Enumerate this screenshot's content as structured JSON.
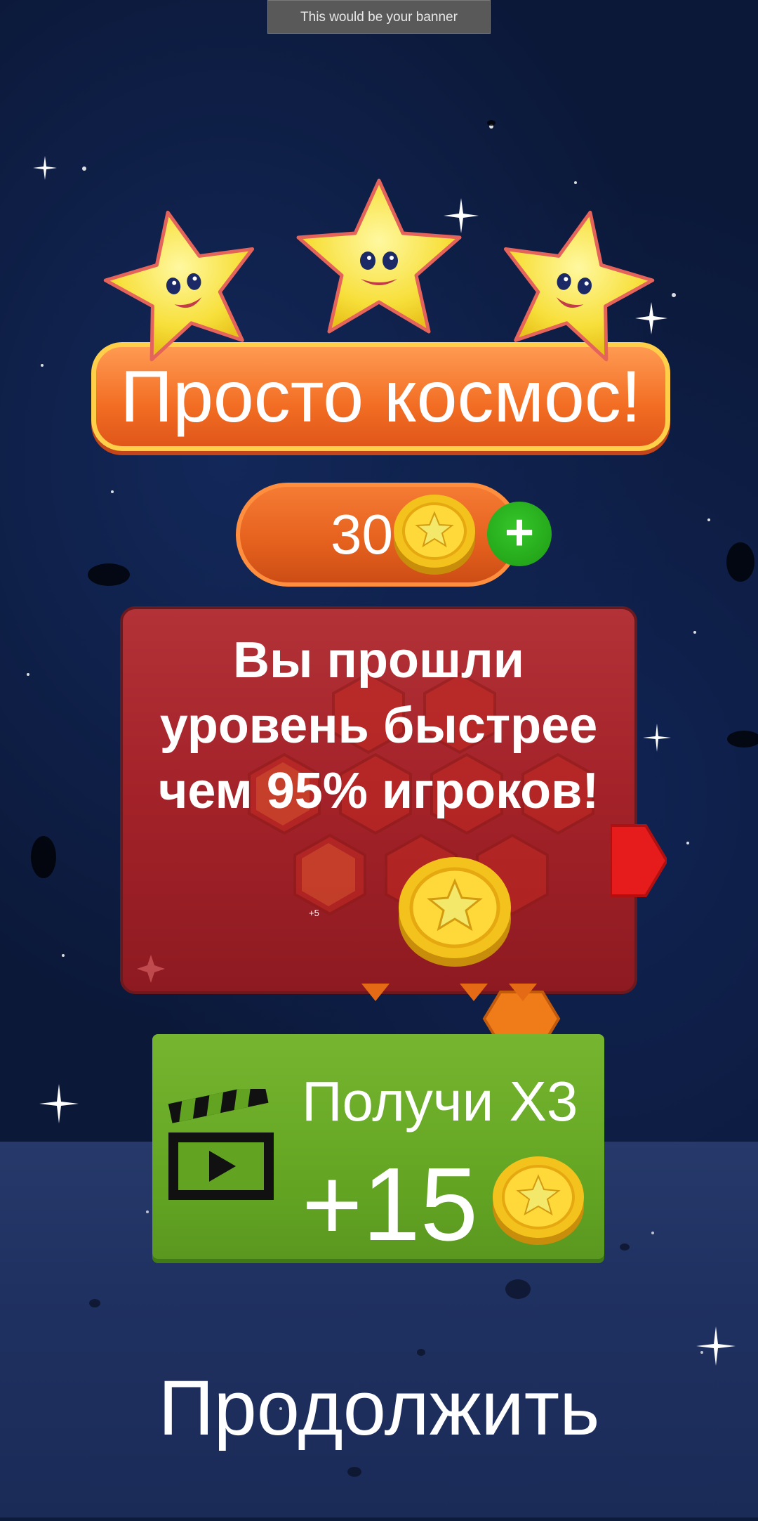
{
  "banner": {
    "text": "This would be your banner"
  },
  "title": {
    "text": "Просто космос!"
  },
  "stars_earned": 3,
  "coins": {
    "count": "30"
  },
  "message": {
    "line1": "Вы прошли",
    "line2": "уровень быстрее",
    "line3": "чем 95% игроков!",
    "small_plus": "+5"
  },
  "bonus_button": {
    "label": "Получи X3",
    "amount": "+15"
  },
  "continue_button": {
    "label": "Продолжить"
  },
  "colors": {
    "title_orange": "#f26d23",
    "panel_red": "#a32229",
    "bonus_green": "#62a422",
    "plus_green": "#1e9b14",
    "coin_gold": "#f4c21c"
  }
}
